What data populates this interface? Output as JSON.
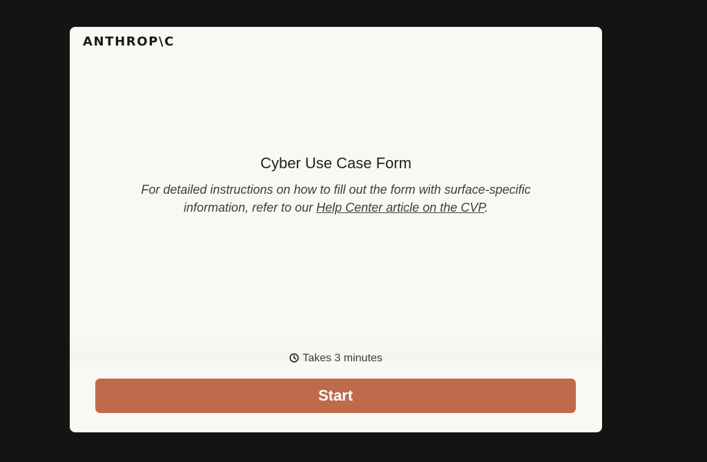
{
  "brand": {
    "logo_text": "ANTHROP\\C"
  },
  "form": {
    "title": "Cyber Use Case Form",
    "description_before": "For detailed instructions on how to fill out the form with surface-specific information, refer to our ",
    "help_link_text": "Help Center article on the CVP",
    "description_after": "."
  },
  "footer": {
    "duration_text": "Takes 3 minutes",
    "duration_icon": "clock-icon",
    "start_label": "Start"
  },
  "colors": {
    "background": "#141413",
    "card": "#f9f8f4",
    "accent": "#bf6b4b"
  }
}
